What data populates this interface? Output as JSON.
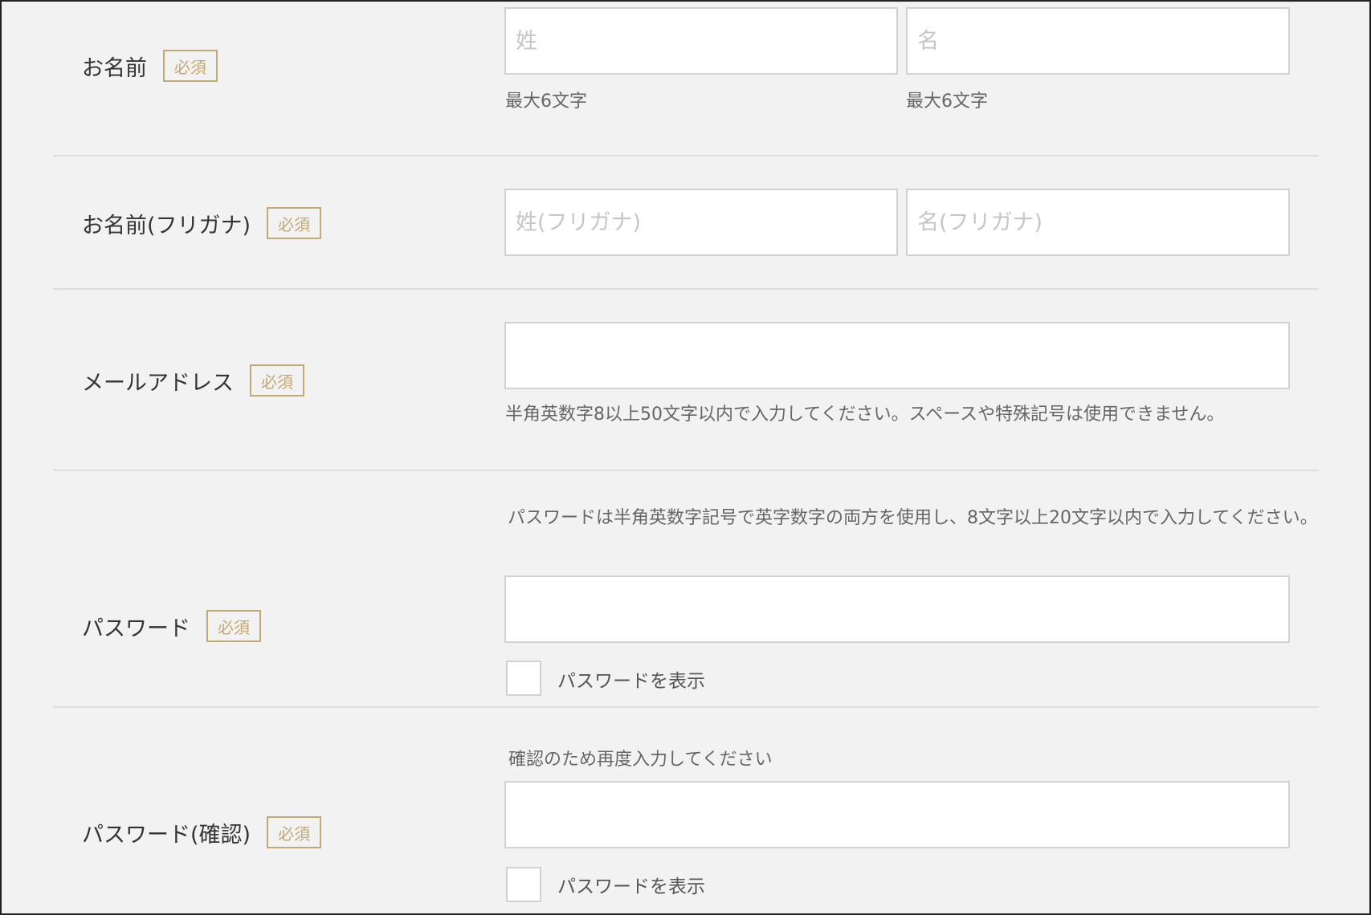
{
  "required_badge": "必須",
  "rows": {
    "name": {
      "label": "お名前",
      "last_placeholder": "姓",
      "first_placeholder": "名",
      "last_note": "最大6文字",
      "first_note": "最大6文字"
    },
    "furigana": {
      "label": "お名前(フリガナ)",
      "last_placeholder": "姓(フリガナ)",
      "first_placeholder": "名(フリガナ)"
    },
    "email": {
      "label": "メールアドレス",
      "note": "半角英数字8以上50文字以内で入力してください。スペースや特殊記号は使用できません。"
    },
    "password": {
      "label": "パスワード",
      "note": "パスワードは半角英数字記号で英字数字の両方を使用し、8文字以上20文字以内で入力してください。",
      "show_label": "パスワードを表示"
    },
    "password_confirm": {
      "label": "パスワード(確認)",
      "note": "確認のため再度入力してください",
      "show_label": "パスワードを表示"
    }
  },
  "colors": {
    "background": "#f2f2f2",
    "badge": "#c2a872",
    "field_border": "#d2d2d2"
  }
}
